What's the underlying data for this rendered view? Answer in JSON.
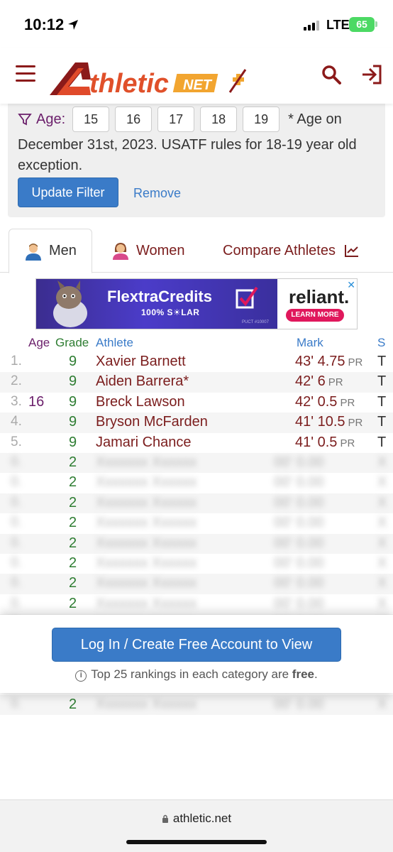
{
  "status_bar": {
    "time": "10:12",
    "network": "LTE",
    "battery": "65"
  },
  "nav": {
    "logo_main": "thletic",
    "logo_net": "NET"
  },
  "filter": {
    "age_label": "Age:",
    "ages": [
      "15",
      "16",
      "17",
      "18",
      "19"
    ],
    "age_note": "* Age on",
    "description": "December 31st, 2023. USATF rules for 18-19 year old exception.",
    "update_button": "Update Filter",
    "remove_link": "Remove"
  },
  "tabs": {
    "men": "Men",
    "women": "Women",
    "compare": "Compare Athletes"
  },
  "ad": {
    "title": "FlextraCredits",
    "subtitle": "100% S☀LAR",
    "puct": "PUCT #10007",
    "brand": "reliant.",
    "cta": "LEARN MORE"
  },
  "table": {
    "headers": {
      "age": "Age",
      "grade": "Grade",
      "athlete": "Athlete",
      "mark": "Mark",
      "school": "S"
    },
    "rows": [
      {
        "rank": "1.",
        "age": "",
        "grade": "9",
        "name": "Xavier Barnett",
        "mark": "43' 4.75",
        "pr": "PR",
        "school": "T"
      },
      {
        "rank": "2.",
        "age": "",
        "grade": "9",
        "name": "Aiden Barrera*",
        "mark": "42' 6",
        "pr": "PR",
        "school": "T"
      },
      {
        "rank": "3.",
        "age": "16",
        "grade": "9",
        "name": "Breck Lawson",
        "mark": "42' 0.5",
        "pr": "PR",
        "school": "T"
      },
      {
        "rank": "4.",
        "age": "",
        "grade": "9",
        "name": "Bryson McFarden",
        "mark": "41' 10.5",
        "pr": "PR",
        "school": "T"
      },
      {
        "rank": "5.",
        "age": "",
        "grade": "9",
        "name": "Jamari Chance",
        "mark": "41' 0.5",
        "pr": "PR",
        "school": "T"
      }
    ],
    "blurred_grades": [
      "2",
      "2",
      "2",
      "2",
      "2",
      "2",
      "2",
      "2",
      "2",
      "2",
      "2",
      "2",
      "2"
    ]
  },
  "login": {
    "button": "Log In / Create Free Account to View",
    "note_prefix": "Top 25 rankings in each category are ",
    "note_bold": "free",
    "note_suffix": "."
  },
  "url_bar": {
    "url": "athletic.net"
  },
  "colors": {
    "brand_maroon": "#7b1d1d",
    "link_blue": "#3a7bc8",
    "grade_green": "#2e7d32",
    "age_purple": "#6b1f6b"
  }
}
